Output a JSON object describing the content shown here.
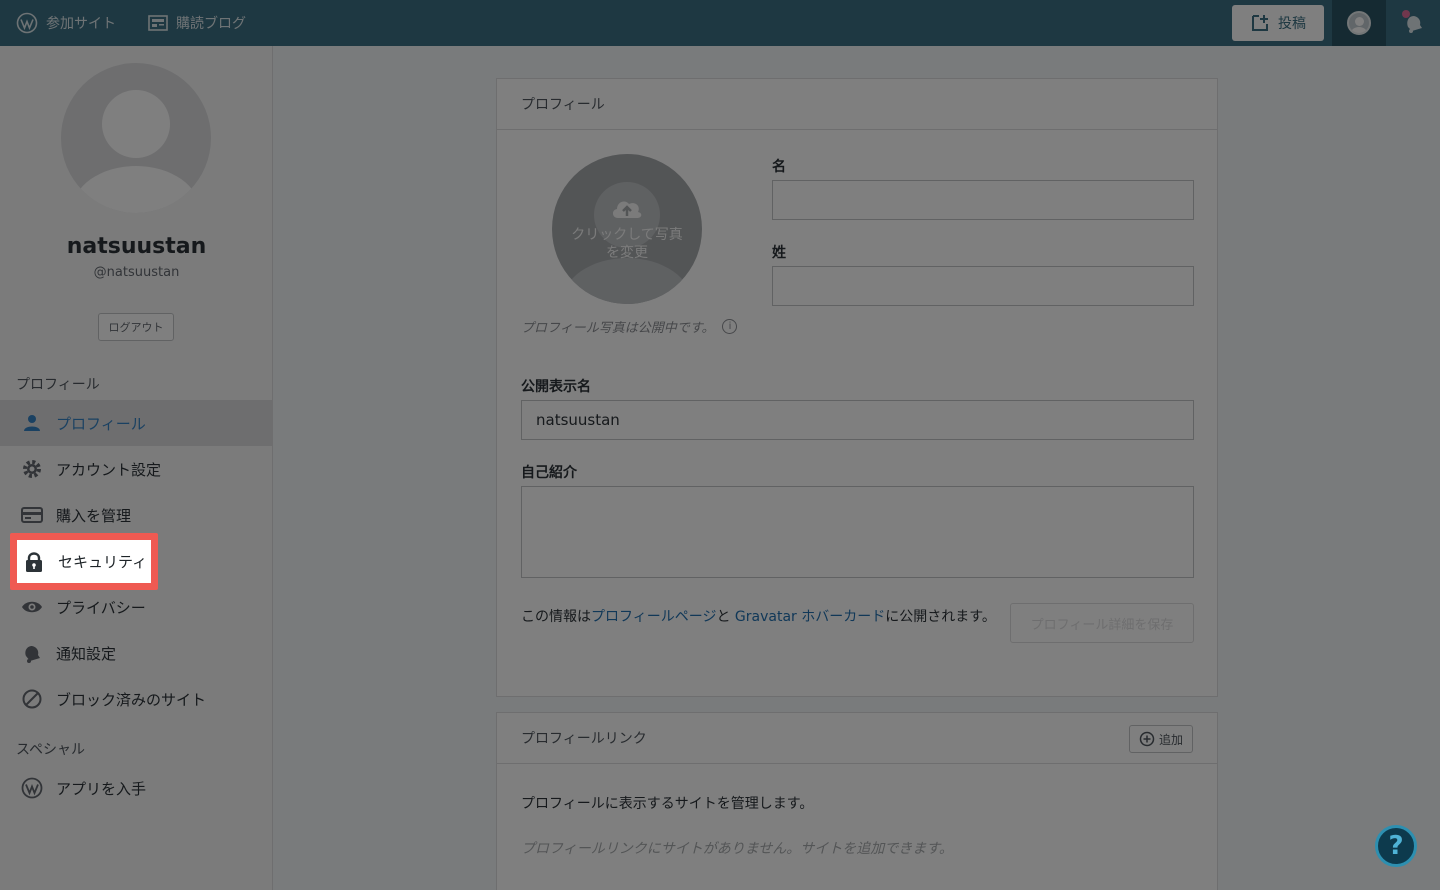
{
  "masterbar": {
    "my_sites": "参加サイト",
    "reader": "購読ブログ",
    "write": "投稿"
  },
  "sidebar": {
    "display_name": "natsuustan",
    "username": "@natsuustan",
    "logout": "ログアウト",
    "section_profile": "プロフィール",
    "items": [
      {
        "label": "プロフィール",
        "icon": "person-icon"
      },
      {
        "label": "アカウント設定",
        "icon": "gear-icon"
      },
      {
        "label": "購入を管理",
        "icon": "credit-card-icon"
      },
      {
        "label": "セキュリティ",
        "icon": "lock-icon"
      },
      {
        "label": "プライバシー",
        "icon": "eye-icon"
      },
      {
        "label": "通知設定",
        "icon": "bell-icon"
      },
      {
        "label": "ブロック済みのサイト",
        "icon": "blocked-icon"
      }
    ],
    "section_special": "スペシャル",
    "special_items": [
      {
        "label": "アプリを入手",
        "icon": "wordpress-icon"
      }
    ]
  },
  "profile_card": {
    "header": "プロフィール",
    "photo_overlay": "クリックして写真を変更",
    "photo_note": "プロフィール写真は公開中です。",
    "first_name_label": "名",
    "first_name_value": "",
    "last_name_label": "姓",
    "last_name_value": "",
    "display_name_label": "公開表示名",
    "display_name_value": "natsuustan",
    "bio_label": "自己紹介",
    "bio_value": "",
    "footer_prefix": "この情報は",
    "footer_link1": "プロフィールページ",
    "footer_mid": "と ",
    "footer_link2": "Gravatar ホバーカード",
    "footer_suffix": "に公開されます。",
    "save_button": "プロフィール詳細を保存"
  },
  "links_card": {
    "header": "プロフィールリンク",
    "add_button": "追加",
    "description": "プロフィールに表示するサイトを管理します。",
    "empty": "プロフィールリンクにサイトがありません。サイトを追加できます。"
  },
  "highlight": {
    "label": "セキュリティ",
    "border_color": "#ef5a52"
  },
  "help": {
    "glyph": "?"
  }
}
